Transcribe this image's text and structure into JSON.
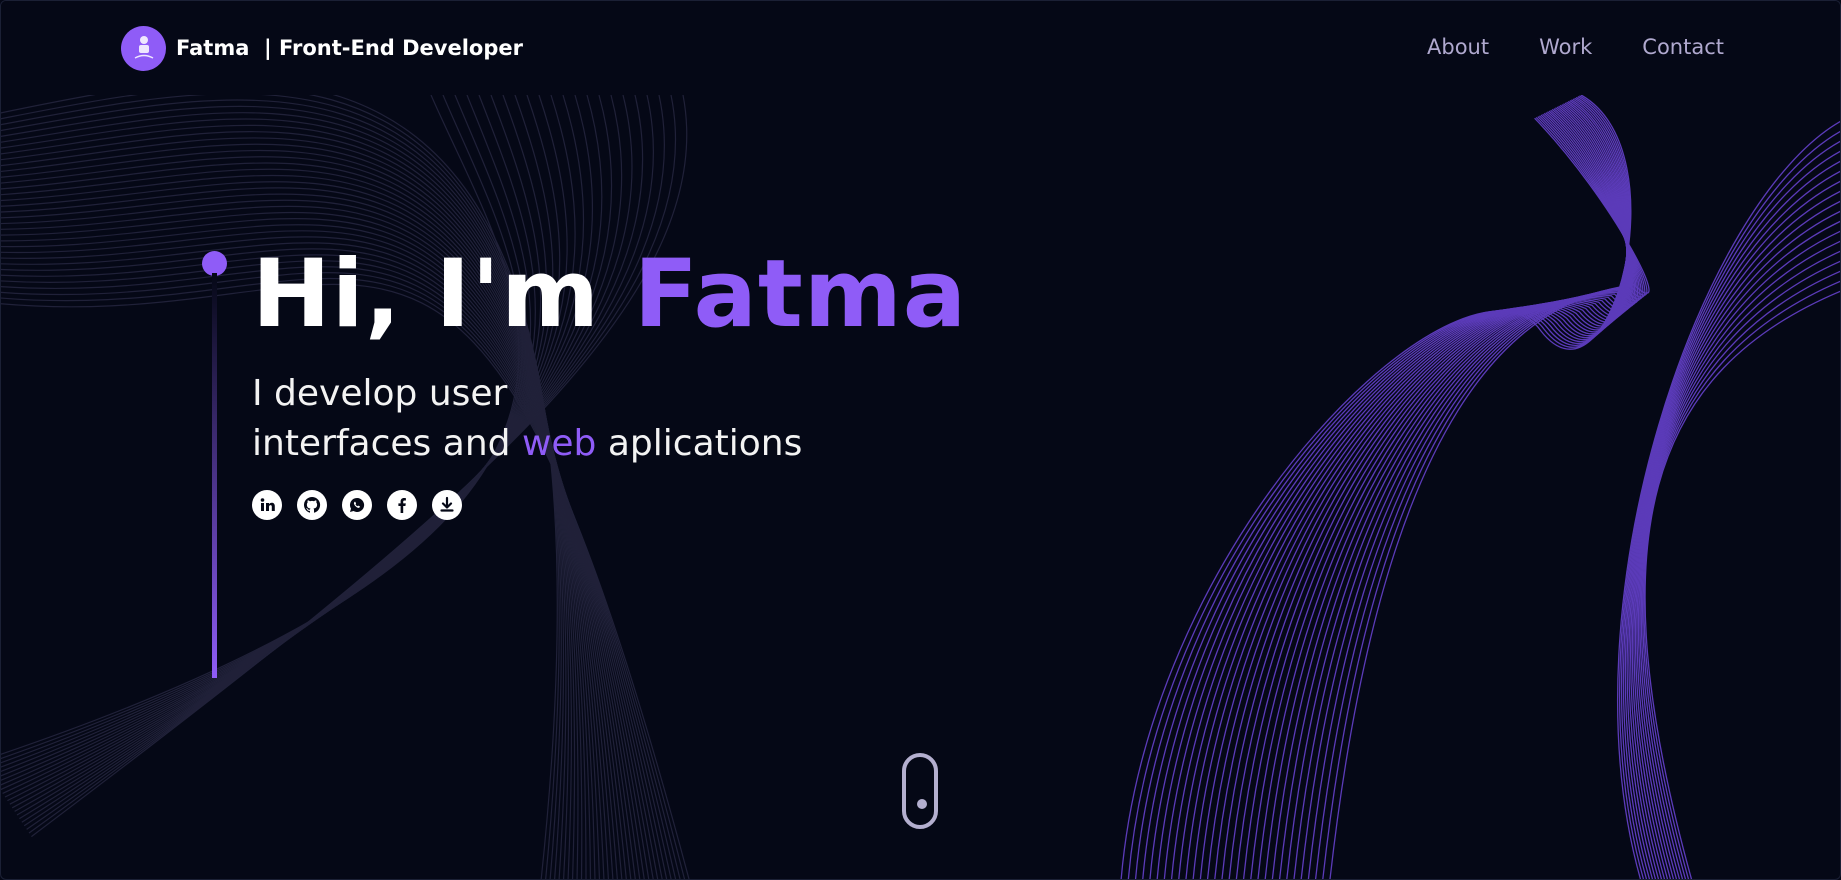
{
  "nav": {
    "brand_name": "Fatma",
    "brand_title": "Front-End Developer",
    "links": [
      {
        "label": "About"
      },
      {
        "label": "Work"
      },
      {
        "label": "Contact"
      }
    ]
  },
  "hero": {
    "greeting": "Hi, I'm",
    "name": "Fatma",
    "subtitle_line1": "I develop user",
    "subtitle_line2_before": "interfaces and",
    "subtitle_line2_accent": "web",
    "subtitle_line2_after": "aplications",
    "social_icons": [
      "linkedin-icon",
      "github-icon",
      "whatsapp-icon",
      "facebook-icon",
      "download-icon"
    ]
  },
  "colors": {
    "background": "#050816",
    "accent": "#8f5cf7",
    "nav_link": "#b0a9cf"
  }
}
